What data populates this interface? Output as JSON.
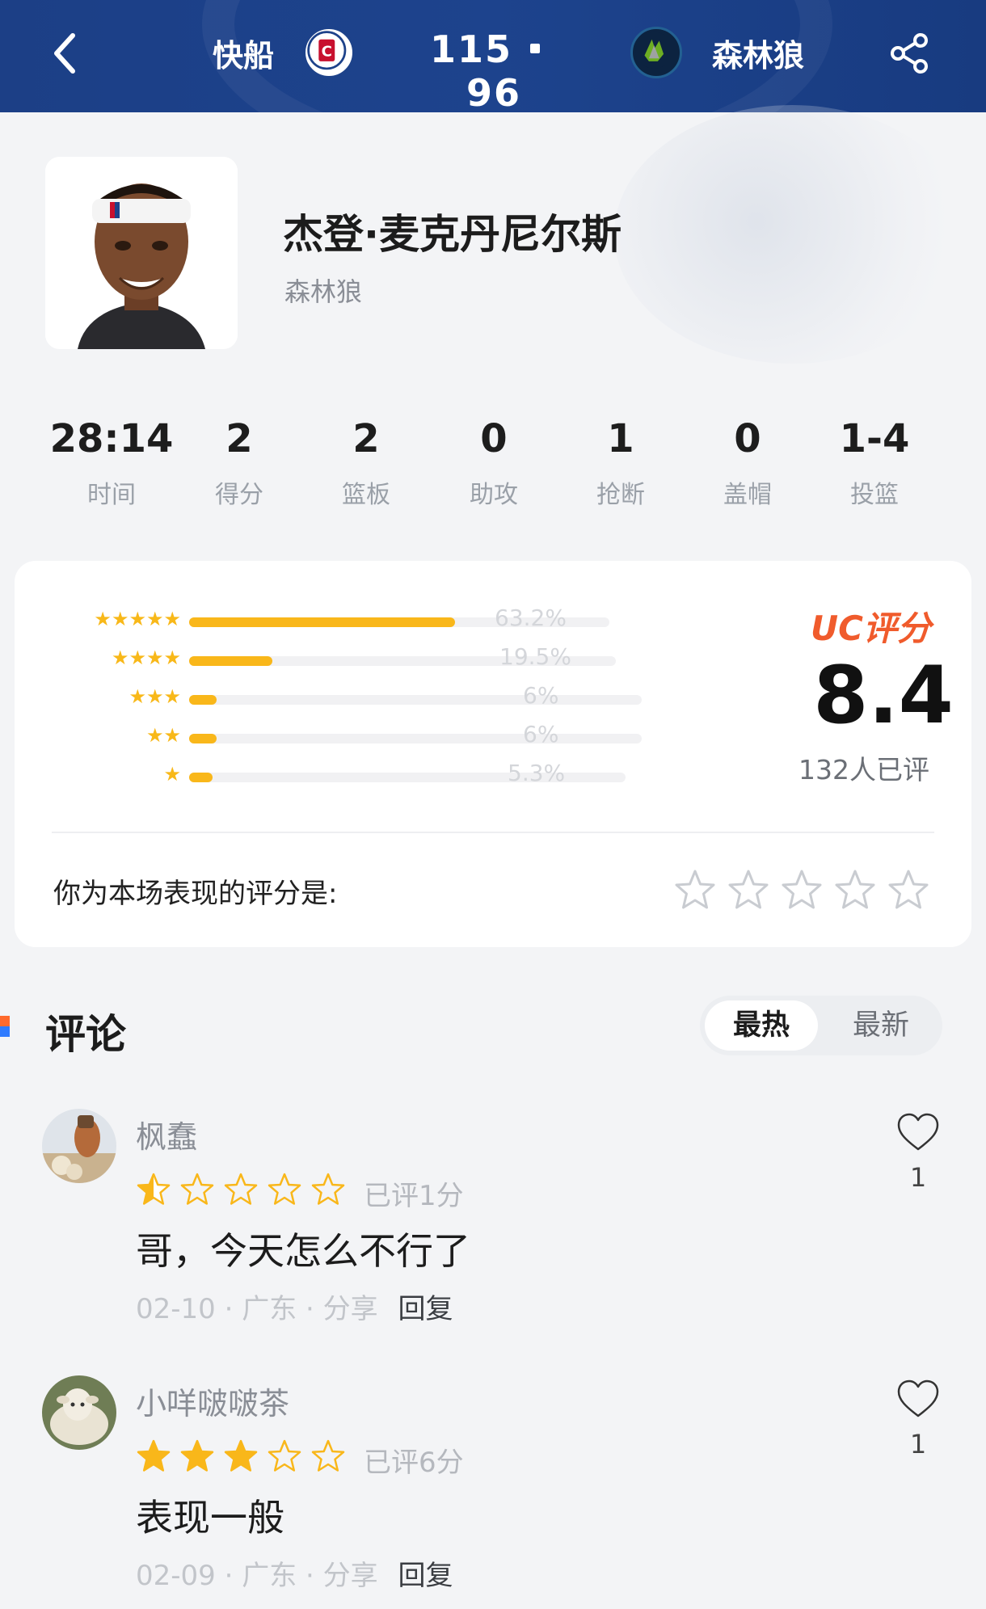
{
  "header": {
    "home_team": "快船",
    "away_team": "森林狼",
    "home_score": "115",
    "away_score": "96",
    "accent_color": "#1d438d"
  },
  "player": {
    "name": "杰登·麦克丹尼尔斯",
    "team": "森林狼"
  },
  "stats": [
    {
      "value": "28:14",
      "label": "时间"
    },
    {
      "value": "2",
      "label": "得分"
    },
    {
      "value": "2",
      "label": "篮板"
    },
    {
      "value": "0",
      "label": "助攻"
    },
    {
      "value": "1",
      "label": "抢断"
    },
    {
      "value": "0",
      "label": "盖帽"
    },
    {
      "value": "1-4",
      "label": "投篮"
    }
  ],
  "rating": {
    "distribution": [
      {
        "stars": 5,
        "percent": 63.2,
        "label": "63.2%"
      },
      {
        "stars": 4,
        "percent": 19.5,
        "label": "19.5%"
      },
      {
        "stars": 3,
        "percent": 6,
        "label": "6%"
      },
      {
        "stars": 2,
        "percent": 6,
        "label": "6%"
      },
      {
        "stars": 1,
        "percent": 5.3,
        "label": "5.3%"
      }
    ],
    "uc_label": "UC评分",
    "score": "8.4",
    "count_label": "132人已评",
    "my_rating_prompt": "你为本场表现的评分是:",
    "my_rating_value": 0,
    "star_color": "#f9b71a",
    "brand_color": "#f05b2c"
  },
  "comments_section": {
    "title": "评论",
    "sort_tabs": [
      "最热",
      "最新"
    ],
    "active_tab": "最热"
  },
  "comments": [
    {
      "user": "枫蠢",
      "stars": 1,
      "rated_label": "已评1分",
      "text": "哥，今天怎么不行了",
      "date": "02-10",
      "location": "广东",
      "share_label": "分享",
      "reply_label": "回复",
      "likes": "1"
    },
    {
      "user": "小咩啵啵茶",
      "stars": 3,
      "rated_label": "已评6分",
      "text": "表现一般",
      "date": "02-09",
      "location": "广东",
      "share_label": "分享",
      "reply_label": "回复",
      "likes": "1"
    }
  ]
}
